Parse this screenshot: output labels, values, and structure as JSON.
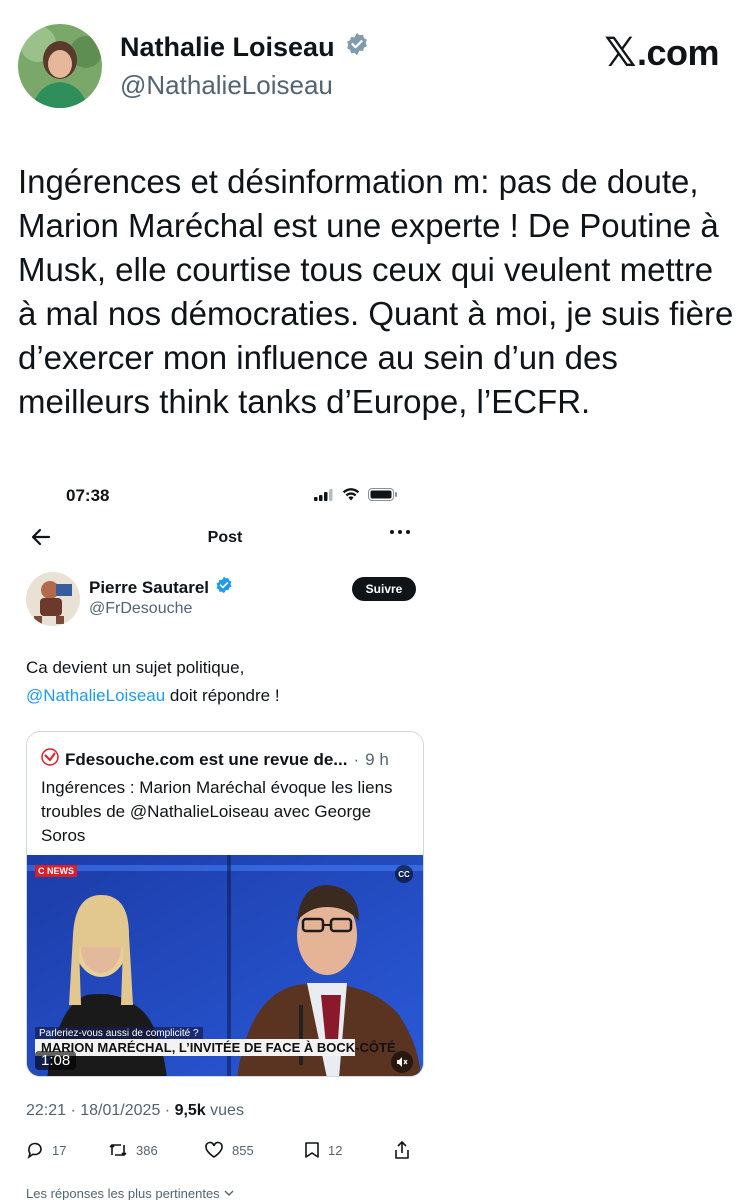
{
  "outer": {
    "author_name": "Nathalie Loiseau",
    "author_handle": "@NathalieLoiseau",
    "brand": ".com",
    "brand_x": "𝕏",
    "text": "Ingérences et désinformation m: pas de doute, Marion Maréchal est une experte ! De Poutine à Musk, elle courtise tous ceux qui veulent mettre à mal nos démocraties. Quant à moi, je suis fière d’exercer mon influence au sein d’un des meilleurs think tanks d’Europe, l’ECFR."
  },
  "phone": {
    "time": "07:38",
    "page_title": "Post",
    "back_icon": "back-arrow-icon",
    "more_icon": "more-dots-icon"
  },
  "inner_post": {
    "author_name": "Pierre Sautarel",
    "author_handle": "@FrDesouche",
    "follow_label": "Suivre",
    "text_line1": "Ca devient un sujet politique,",
    "mention": "@NathalieLoiseau",
    "text_line2_rest": " doit répondre !",
    "card": {
      "source": "Fdesouche.com est une revue de...",
      "dot": "·",
      "age": "9 h",
      "body": "Ingérences : Marion Maréchal évoque les liens troubles de @NathalieLoiseau avec George Soros",
      "video": {
        "channel_logo": "C NEWS",
        "caption_small": "Parleriez-vous aussi de complicité ?",
        "caption": "MARION MARÉCHAL, L’INVITÉE DE FACE À BOCK-CÔTÉ",
        "duration": "1:08"
      }
    },
    "timestamp": "22:21 · 18/01/2025 · ",
    "views_count": "9,5k",
    "views_label": " vues",
    "actions": {
      "replies": "17",
      "reposts": "386",
      "likes": "855",
      "bookmarks": "12"
    },
    "replies_sort": "Les réponses les plus pertinentes"
  },
  "colors": {
    "accent": "#1d9bf0",
    "text": "#0f1419",
    "muted": "#536471"
  }
}
